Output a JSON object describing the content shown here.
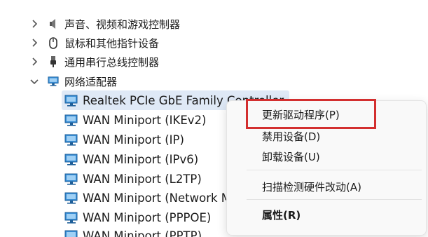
{
  "tree": {
    "categories": [
      {
        "label": "声音、视频和游戏控制器",
        "expanded": false,
        "icon": "speaker-icon"
      },
      {
        "label": "鼠标和其他指针设备",
        "expanded": false,
        "icon": "mouse-icon"
      },
      {
        "label": "通用串行总线控制器",
        "expanded": false,
        "icon": "usb-icon"
      },
      {
        "label": "网络适配器",
        "expanded": true,
        "icon": "network-adapter-icon"
      }
    ],
    "children": [
      {
        "label": "Realtek PCIe GbE Family Controller",
        "selected": true
      },
      {
        "label": "WAN Miniport (IKEv2)"
      },
      {
        "label": "WAN Miniport (IP)"
      },
      {
        "label": "WAN Miniport (IPv6)"
      },
      {
        "label": "WAN Miniport (L2TP)"
      },
      {
        "label": "WAN Miniport (Network Monitor)"
      },
      {
        "label": "WAN Miniport (PPPOE)"
      },
      {
        "label": "WAN Miniport (PPTP)"
      }
    ]
  },
  "context_menu": {
    "items": [
      {
        "label": "更新驱动程序(P)",
        "highlighted": true
      },
      {
        "label": "禁用设备(D)"
      },
      {
        "label": "卸载设备(U)"
      },
      {
        "label": "扫描检测硬件改动(A)"
      },
      {
        "label": "属性(R)",
        "bold": true
      }
    ]
  },
  "colors": {
    "selection": "#dfe9f6",
    "highlight_box": "#d32f2f",
    "adapter_icon": "#2f7fc1"
  }
}
